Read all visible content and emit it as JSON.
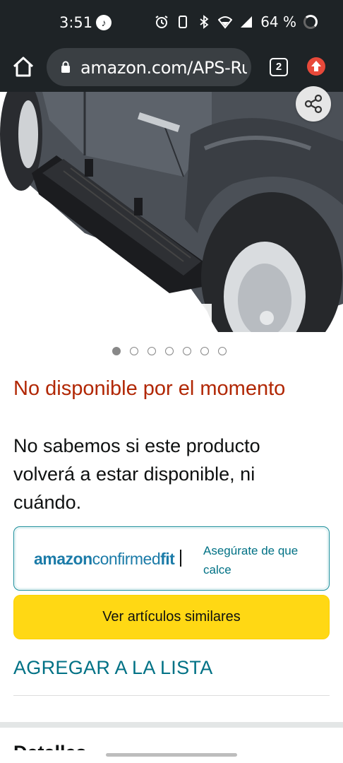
{
  "status_bar": {
    "time": "3:51",
    "battery_percent": "64 %",
    "icons": [
      "tiktok-icon",
      "alarm-icon",
      "vibrate-icon",
      "bluetooth-icon",
      "wifi-icon",
      "signal-icon",
      "battery-icon"
    ]
  },
  "browser": {
    "url": "amazon.com/APS-Ru",
    "tab_count": "2",
    "icons": [
      "home-icon",
      "lock-icon",
      "tabs-icon",
      "update-icon"
    ]
  },
  "product": {
    "image_alt": "running board on truck",
    "share_icon": "share-icon",
    "carousel_pages": 7,
    "carousel_active": 0,
    "availability_title": "No disponible por el momento",
    "availability_desc": "No sabemos si este producto volverá a estar disponible, ni cuándo."
  },
  "confirmed_fit": {
    "logo_amazon": "amazon",
    "logo_confirmed": "confirmed",
    "logo_fit": "fit",
    "separator": "|",
    "link": "Asegúrate de que calce"
  },
  "actions": {
    "similar_button": "Ver artículos similares",
    "add_to_list": "AGREGAR A LA LISTA"
  },
  "next_section": {
    "heading_partial": "Detalles"
  },
  "colors": {
    "status_bg": "#1e2326",
    "unavailable": "#b12704",
    "link": "#007185",
    "button_yellow": "#ffd814"
  }
}
